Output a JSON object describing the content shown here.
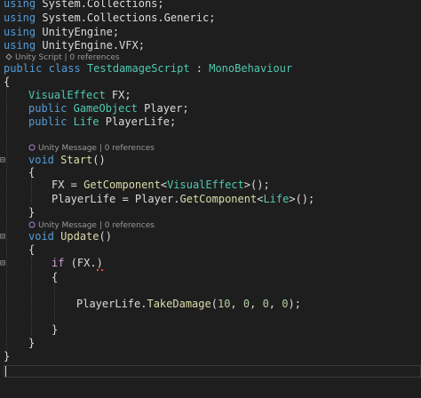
{
  "usings": [
    {
      "kw": "using",
      "ns": "System.Collections;"
    },
    {
      "kw": "using",
      "ns": "System.Collections.Generic;"
    },
    {
      "kw": "using",
      "ns": "UnityEngine;"
    },
    {
      "kw": "using",
      "ns": "UnityEngine.VFX;"
    }
  ],
  "class_lens": "Unity Script | 0 references",
  "class_decl": {
    "mod": "public",
    "kw": "class",
    "name": "TestdamageScript",
    "sep": " : ",
    "base": "MonoBehaviour"
  },
  "fields": [
    {
      "mod": "",
      "type": "VisualEffect",
      "rest": " FX;"
    },
    {
      "mod": "public",
      "type": "GameObject",
      "rest": " Player;"
    },
    {
      "mod": "public",
      "type": "Life",
      "rest": " PlayerLife;"
    }
  ],
  "start_lens": "Unity Message | 0 references",
  "start_decl": {
    "kw": "void",
    "name": "Start",
    "rest": "()"
  },
  "start_body": {
    "line1": {
      "lhs": "FX = ",
      "fn": "GetComponent",
      "lt": "<",
      "type": "VisualEffect",
      "gt": ">();"
    },
    "line2": {
      "lhs": "PlayerLife = Player.",
      "fn": "GetComponent",
      "lt": "<",
      "type": "Life",
      "gt": ">();"
    }
  },
  "update_lens": "Unity Message | 0 references",
  "update_decl": {
    "kw": "void",
    "name": "Update",
    "rest": "()"
  },
  "if_line": {
    "kw": "if",
    "open": " (FX.",
    "err": ")"
  },
  "call_line": {
    "obj": "PlayerLife.",
    "fn": "TakeDamage",
    "open": "(",
    "a1": "10",
    "c1": ", ",
    "a2": "0",
    "c2": ", ",
    "a3": "0",
    "c3": ", ",
    "a4": "0",
    "close": ");"
  },
  "braces": {
    "open": "{",
    "close": "}"
  }
}
